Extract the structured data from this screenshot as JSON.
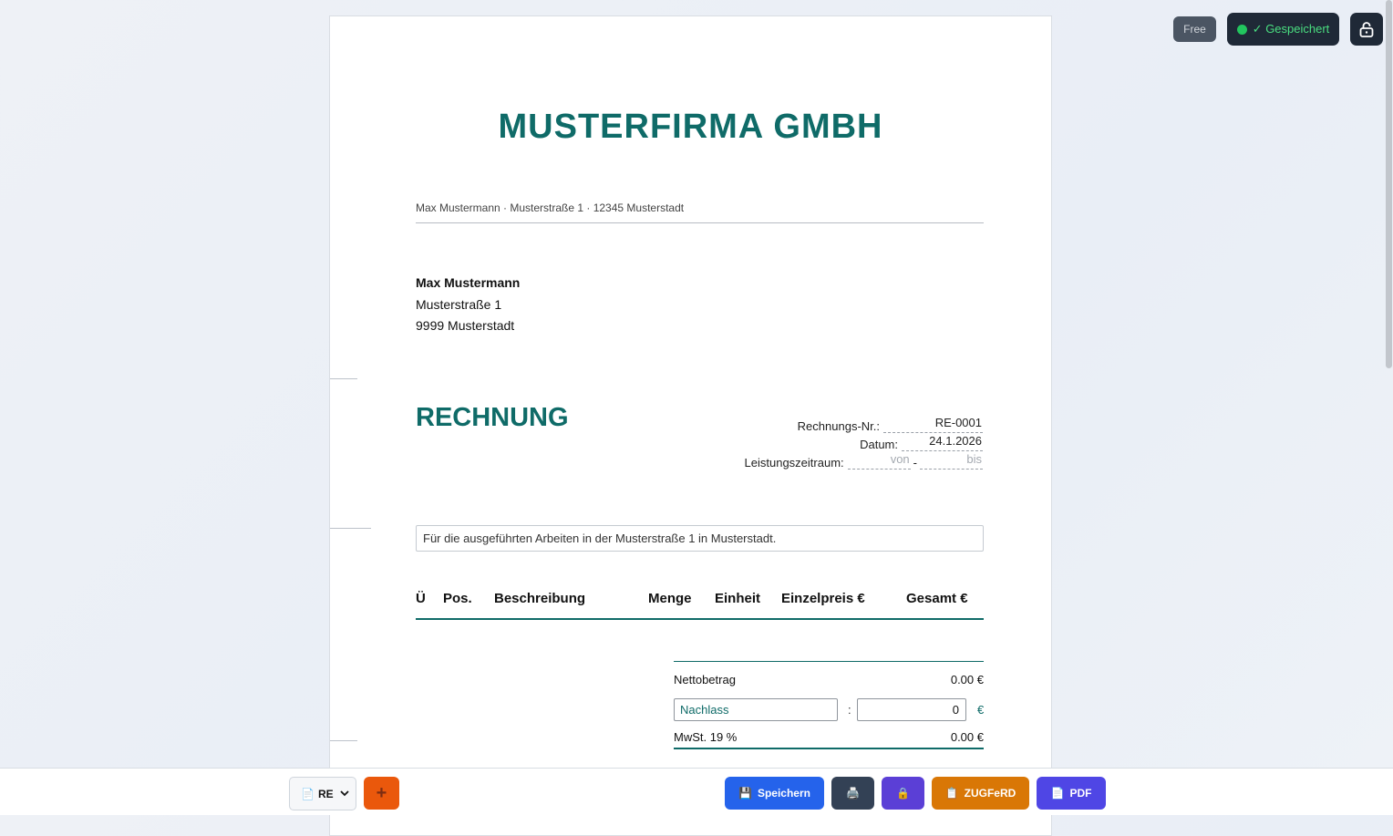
{
  "header": {
    "plan_badge": "Free",
    "save_status": "✓ Gespeichert",
    "lock_icon": "lock-icon"
  },
  "document": {
    "company_name": "MUSTERFIRMA GMBH",
    "sender_line": "Max Mustermann · Musterstraße 1 · 12345 Musterstadt",
    "recipient": {
      "name": "Max Mustermann",
      "street": "Musterstraße 1",
      "city": "9999 Musterstadt"
    },
    "title": "RECHNUNG",
    "meta": {
      "invoice_no_label": "Rechnungs-Nr.:",
      "invoice_no": "RE-0001",
      "date_label": "Datum:",
      "date": "24.1.2026",
      "period_label": "Leistungszeitraum:",
      "period_from_placeholder": "von",
      "period_separator": "-",
      "period_to_placeholder": "bis"
    },
    "intro_text": "Für die ausgeführten Arbeiten in der Musterstraße 1 in Musterstadt.",
    "table_headers": [
      "Ü",
      "Pos.",
      "Beschreibung",
      "Menge",
      "Einheit",
      "Einzelpreis €",
      "Gesamt €"
    ],
    "totals": {
      "net_label": "Nettobetrag",
      "net_value": "0.00 €",
      "discount_label": "Nachlass",
      "discount_colon": ":",
      "discount_value": "0",
      "discount_unit": "€",
      "vat_label": "MwSt. 19 %",
      "vat_value": "0.00 €"
    }
  },
  "toolbar": {
    "doc_type_select": "RE",
    "add_label": "+",
    "save_label": "Speichern",
    "print_icon": "printer-icon",
    "lock_icon": "lock-icon",
    "zugferd_label": "ZUGFeRD",
    "pdf_label": "PDF"
  },
  "colors": {
    "accent": "#0f6b68",
    "save": "#2563eb",
    "zugferd": "#d97706",
    "pdf": "#4f46e5",
    "add": "#ea580c"
  }
}
